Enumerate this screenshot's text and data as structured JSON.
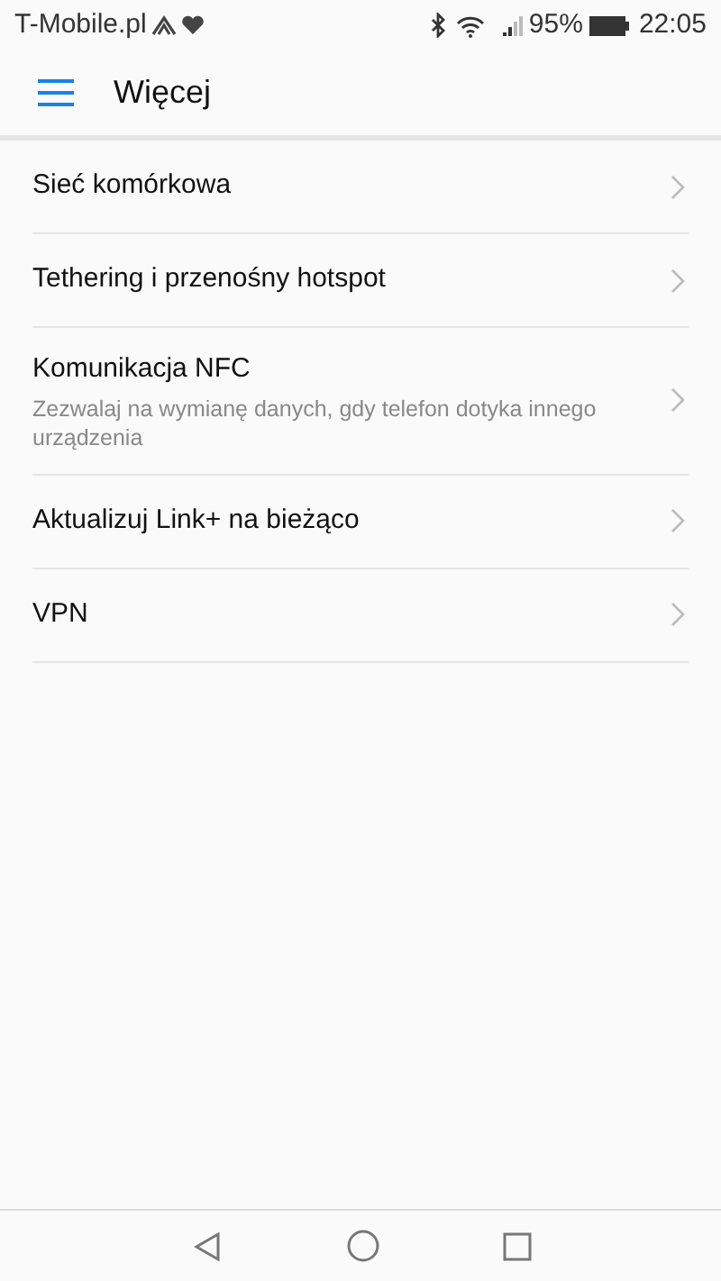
{
  "status_bar": {
    "carrier": "T-Mobile.pl",
    "battery": "95%",
    "time": "22:05"
  },
  "app_bar": {
    "title": "Więcej"
  },
  "items": [
    {
      "title": "Sieć komórkowa"
    },
    {
      "title": "Tethering i przenośny hotspot"
    },
    {
      "title": "Komunikacja NFC",
      "subtitle": "Zezwalaj na wymianę danych, gdy telefon dotyka innego urządzenia"
    },
    {
      "title": "Aktualizuj Link+ na bieżąco"
    },
    {
      "title": "VPN"
    }
  ]
}
